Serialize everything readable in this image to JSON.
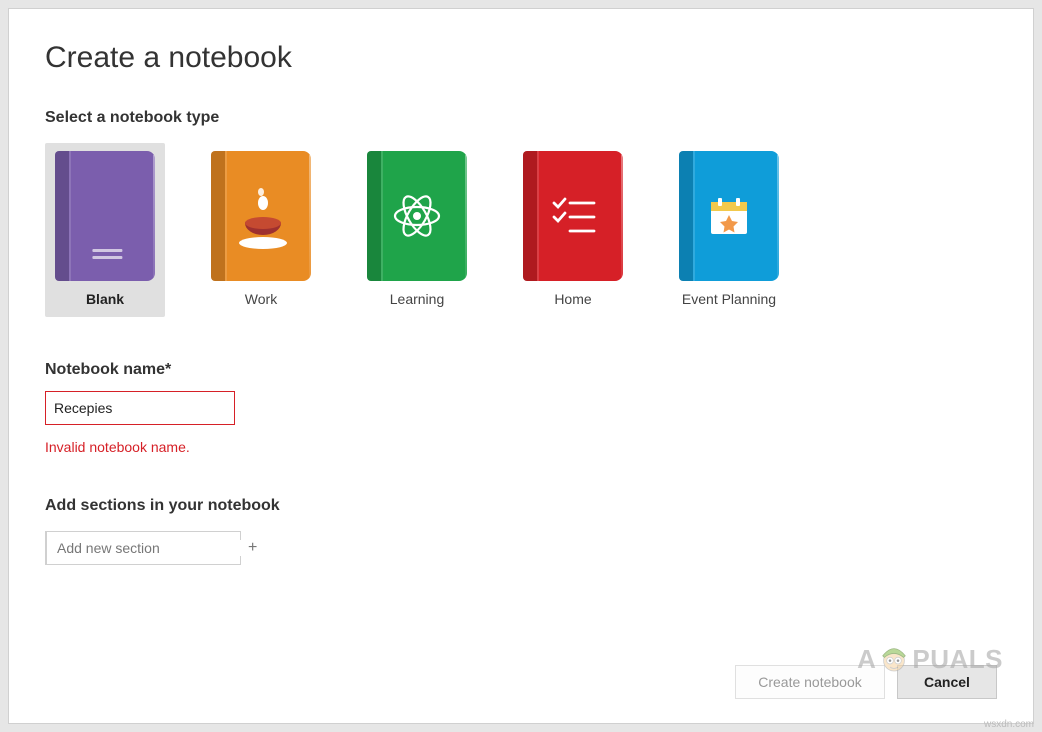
{
  "dialog": {
    "title": "Create a notebook",
    "select_label": "Select a notebook type",
    "types": [
      {
        "label": "Blank",
        "color": "#7b5ead",
        "selected": true
      },
      {
        "label": "Work",
        "color": "#e98c24",
        "selected": false
      },
      {
        "label": "Learning",
        "color": "#1fa44a",
        "selected": false
      },
      {
        "label": "Home",
        "color": "#d62027",
        "selected": false
      },
      {
        "label": "Event Planning",
        "color": "#0f9dd9",
        "selected": false
      }
    ],
    "name_section": {
      "label": "Notebook name*",
      "value": "Recepies",
      "error": "Invalid notebook name."
    },
    "sections": {
      "heading": "Add sections in your notebook",
      "placeholder": "Add new section",
      "plus": "+"
    },
    "footer": {
      "create": "Create notebook",
      "cancel": "Cancel"
    }
  },
  "watermark": {
    "left": "A",
    "right": "PUALS"
  },
  "source": "wsxdn.com"
}
